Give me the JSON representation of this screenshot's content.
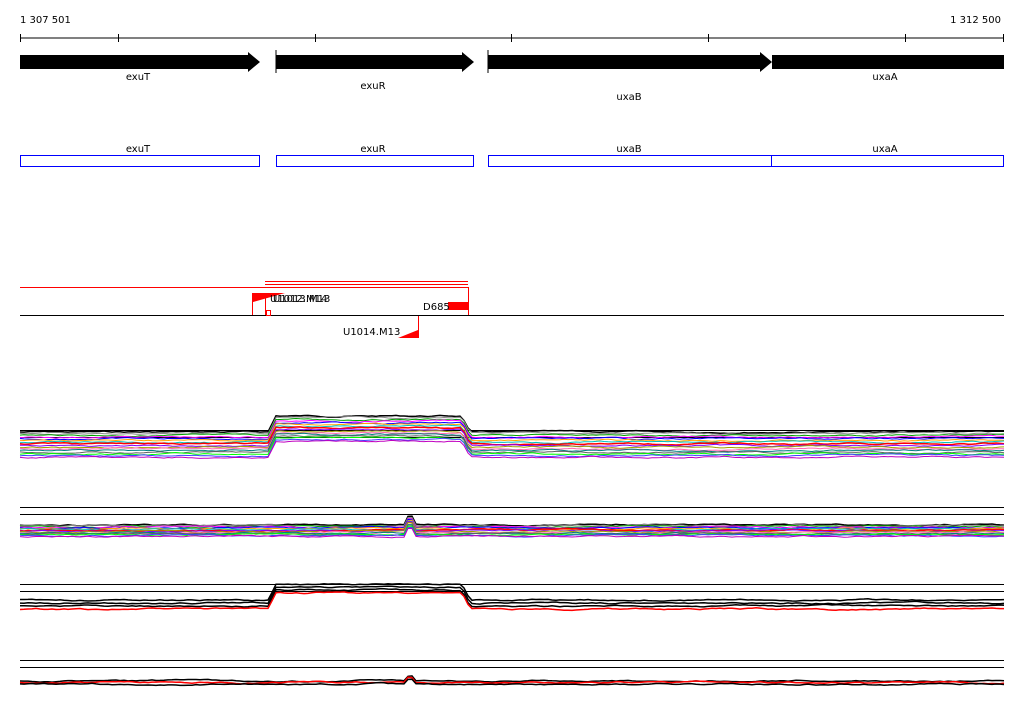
{
  "ruler": {
    "start_label": "1 307 501",
    "end_label": "1 312 500"
  },
  "genes": [
    {
      "name": "exuT"
    },
    {
      "name": "exuR"
    },
    {
      "name": "uxaB"
    },
    {
      "name": "uxaA"
    }
  ],
  "annotations": [
    {
      "name": "exuT"
    },
    {
      "name": "exuR"
    },
    {
      "name": "uxaB"
    },
    {
      "name": "uxaA"
    }
  ],
  "features": {
    "label_a": "U1012.M14",
    "label_b": "U1013.M13",
    "label_c": "D685",
    "label_d": "U1014.M13"
  },
  "colors": {
    "gene": "#000000",
    "annotation": "#0000ff",
    "feature": "#ff0000"
  }
}
